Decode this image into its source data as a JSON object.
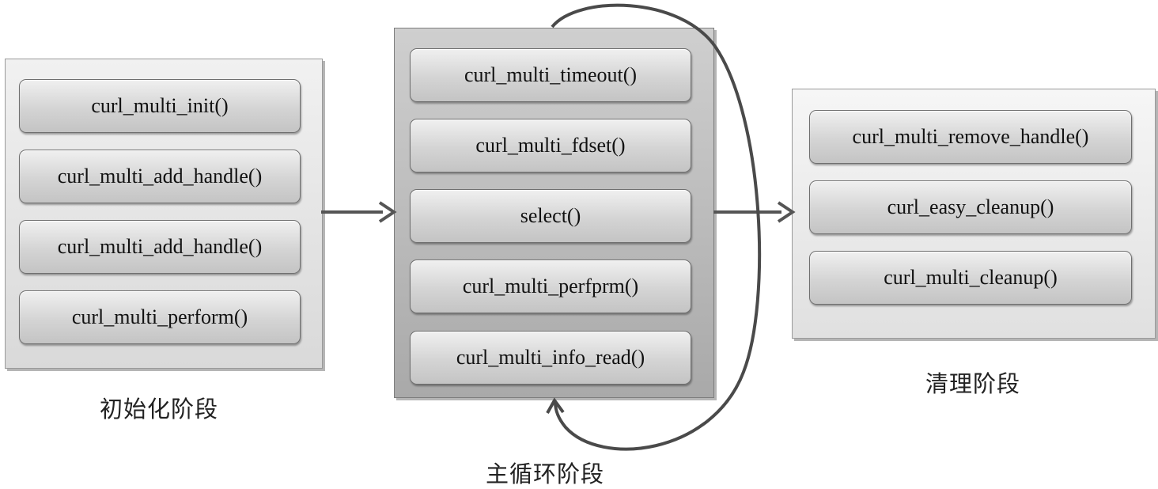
{
  "stages": [
    {
      "caption": "初始化阶段",
      "functions": [
        "curl_multi_init()",
        "curl_multi_add_handle()",
        "curl_multi_add_handle()",
        "curl_multi_perform()"
      ]
    },
    {
      "caption": "主循环阶段",
      "functions": [
        "curl_multi_timeout()",
        "curl_multi_fdset()",
        "select()",
        "curl_multi_perfprm()",
        "curl_multi_info_read()"
      ]
    },
    {
      "caption": "清理阶段",
      "functions": [
        "curl_multi_remove_handle()",
        "curl_easy_cleanup()",
        "curl_multi_cleanup()"
      ]
    }
  ],
  "colors": {
    "arrow": "#555555",
    "loop_arrow": "#4a4a4a"
  }
}
